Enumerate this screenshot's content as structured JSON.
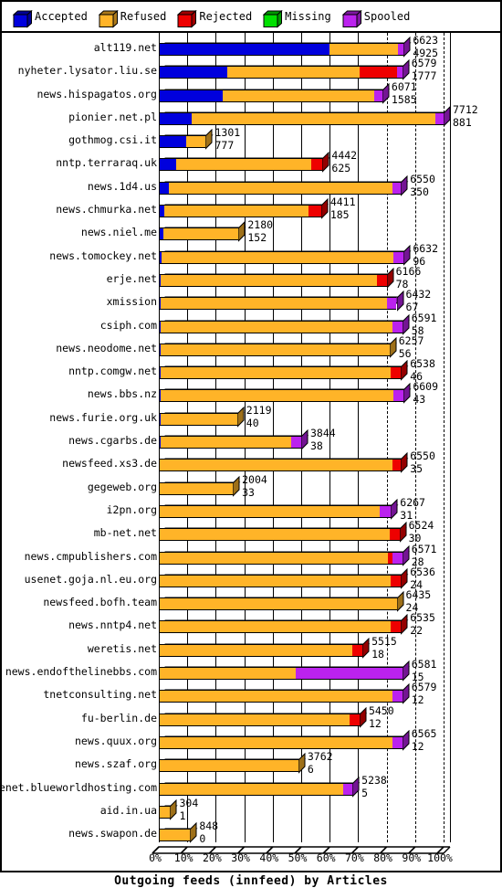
{
  "legend": {
    "items": [
      {
        "label": "Accepted",
        "color": "#0000dd",
        "icon": "cube-icon"
      },
      {
        "label": "Refused",
        "color": "#ffb428",
        "icon": "cube-icon"
      },
      {
        "label": "Rejected",
        "color": "#ee0000",
        "icon": "cube-icon"
      },
      {
        "label": "Missing",
        "color": "#00e000",
        "icon": "cube-icon"
      },
      {
        "label": "Spooled",
        "color": "#bb22ee",
        "icon": "cube-icon"
      }
    ]
  },
  "axis": {
    "title": "Outgoing feeds (innfeed) by Articles",
    "x_ticks": [
      "0%",
      "10%",
      "20%",
      "30%",
      "40%",
      "50%",
      "60%",
      "70%",
      "80%",
      "90%",
      "100%"
    ]
  },
  "chart_data": {
    "type": "bar",
    "orientation": "horizontal",
    "stacked": true,
    "title": "Outgoing feeds (innfeed) by Articles",
    "xlabel": "Outgoing feeds (innfeed) by Articles",
    "ylabel": "",
    "xlim": [
      0,
      100
    ],
    "x_unit": "percent",
    "grid": true,
    "legend_position": "top",
    "series_names": [
      "Accepted",
      "Refused",
      "Rejected",
      "Missing",
      "Spooled"
    ],
    "series_colors": [
      "#0000dd",
      "#ffb428",
      "#ee0000",
      "#00e000",
      "#bb22ee"
    ],
    "categories": [
      "alt119.net",
      "nyheter.lysator.liu.se",
      "news.hispagatos.org",
      "pionier.net.pl",
      "gothmog.csi.it",
      "nntp.terraraq.uk",
      "news.1d4.us",
      "news.chmurka.net",
      "news.niel.me",
      "news.tomockey.net",
      "erje.net",
      "xmission",
      "csiph.com",
      "news.neodome.net",
      "nntp.comgw.net",
      "news.bbs.nz",
      "news.furie.org.uk",
      "news.cgarbs.de",
      "newsfeed.xs3.de",
      "gegeweb.org",
      "i2pn.org",
      "mb-net.net",
      "news.cmpublishers.com",
      "usenet.goja.nl.eu.org",
      "newsfeed.bofh.team",
      "news.nntp4.net",
      "weretis.net",
      "news.endofthelinebbs.com",
      "tnetconsulting.net",
      "fu-berlin.de",
      "news.quux.org",
      "news.szaf.org",
      "usenet.blueworldhosting.com",
      "aid.in.ua",
      "news.swapon.de"
    ],
    "rows": [
      {
        "label": "alt119.net",
        "value_top": "6623",
        "value_bottom": "4925",
        "total_pct": 86,
        "segments": [
          {
            "series": "Accepted",
            "pct": 60.0
          },
          {
            "series": "Refused",
            "pct": 24.0
          },
          {
            "series": "Spooled",
            "pct": 2.0
          }
        ]
      },
      {
        "label": "nyheter.lysator.liu.se",
        "value_top": "6579",
        "value_bottom": "1777",
        "total_pct": 85.5,
        "segments": [
          {
            "series": "Accepted",
            "pct": 24.0
          },
          {
            "series": "Refused",
            "pct": 46.5
          },
          {
            "series": "Rejected",
            "pct": 13.0
          },
          {
            "series": "Spooled",
            "pct": 2.0
          }
        ]
      },
      {
        "label": "news.hispagatos.org",
        "value_top": "6071",
        "value_bottom": "1585",
        "total_pct": 78.5,
        "segments": [
          {
            "series": "Accepted",
            "pct": 22.5
          },
          {
            "series": "Refused",
            "pct": 53.0
          },
          {
            "series": "Spooled",
            "pct": 3.0
          }
        ]
      },
      {
        "label": "pionier.net.pl",
        "value_top": "7712",
        "value_bottom": "881",
        "total_pct": 100.0,
        "segments": [
          {
            "series": "Accepted",
            "pct": 11.5
          },
          {
            "series": "Refused",
            "pct": 85.5
          },
          {
            "series": "Spooled",
            "pct": 3.0
          }
        ]
      },
      {
        "label": "gothmog.csi.it",
        "value_top": "1301",
        "value_bottom": "777",
        "total_pct": 16.5,
        "segments": [
          {
            "series": "Accepted",
            "pct": 9.5
          },
          {
            "series": "Refused",
            "pct": 7.0
          }
        ]
      },
      {
        "label": "nntp.terraraq.uk",
        "value_top": "4442",
        "value_bottom": "625",
        "total_pct": 57.5,
        "segments": [
          {
            "series": "Accepted",
            "pct": 6.0
          },
          {
            "series": "Refused",
            "pct": 47.5
          },
          {
            "series": "Rejected",
            "pct": 4.0
          }
        ]
      },
      {
        "label": "news.1d4.us",
        "value_top": "6550",
        "value_bottom": "350",
        "total_pct": 85.0,
        "segments": [
          {
            "series": "Accepted",
            "pct": 3.5
          },
          {
            "series": "Refused",
            "pct": 78.5
          },
          {
            "series": "Spooled",
            "pct": 3.0
          }
        ]
      },
      {
        "label": "news.chmurka.net",
        "value_top": "4411",
        "value_bottom": "185",
        "total_pct": 57.0,
        "segments": [
          {
            "series": "Accepted",
            "pct": 2.0
          },
          {
            "series": "Refused",
            "pct": 50.5
          },
          {
            "series": "Rejected",
            "pct": 4.5
          }
        ]
      },
      {
        "label": "news.niel.me",
        "value_top": "2180",
        "value_bottom": "152",
        "total_pct": 28.0,
        "segments": [
          {
            "series": "Accepted",
            "pct": 1.5
          },
          {
            "series": "Refused",
            "pct": 26.5
          }
        ]
      },
      {
        "label": "news.tomockey.net",
        "value_top": "6632",
        "value_bottom": "96",
        "total_pct": 86.0,
        "segments": [
          {
            "series": "Accepted",
            "pct": 1.0
          },
          {
            "series": "Refused",
            "pct": 81.5
          },
          {
            "series": "Spooled",
            "pct": 3.5
          }
        ]
      },
      {
        "label": "erje.net",
        "value_top": "6166",
        "value_bottom": "78",
        "total_pct": 80.0,
        "segments": [
          {
            "series": "Accepted",
            "pct": 0.8
          },
          {
            "series": "Refused",
            "pct": 75.7
          },
          {
            "series": "Rejected",
            "pct": 3.5
          }
        ]
      },
      {
        "label": "xmission",
        "value_top": "6432",
        "value_bottom": "67",
        "total_pct": 83.5,
        "segments": [
          {
            "series": "Accepted",
            "pct": 0.7
          },
          {
            "series": "Refused",
            "pct": 79.3
          },
          {
            "series": "Spooled",
            "pct": 3.5
          }
        ]
      },
      {
        "label": "csiph.com",
        "value_top": "6591",
        "value_bottom": "58",
        "total_pct": 85.5,
        "segments": [
          {
            "series": "Accepted",
            "pct": 0.7
          },
          {
            "series": "Refused",
            "pct": 81.3
          },
          {
            "series": "Spooled",
            "pct": 3.5
          }
        ]
      },
      {
        "label": "news.neodome.net",
        "value_top": "6257",
        "value_bottom": "56",
        "total_pct": 81.0,
        "segments": [
          {
            "series": "Accepted",
            "pct": 0.7
          },
          {
            "series": "Refused",
            "pct": 80.3
          }
        ]
      },
      {
        "label": "nntp.comgw.net",
        "value_top": "6538",
        "value_bottom": "46",
        "total_pct": 85.0,
        "segments": [
          {
            "series": "Accepted",
            "pct": 0.6
          },
          {
            "series": "Refused",
            "pct": 80.9
          },
          {
            "series": "Rejected",
            "pct": 3.5
          }
        ]
      },
      {
        "label": "news.bbs.nz",
        "value_top": "6609",
        "value_bottom": "43",
        "total_pct": 86.0,
        "segments": [
          {
            "series": "Accepted",
            "pct": 0.5
          },
          {
            "series": "Refused",
            "pct": 82.0
          },
          {
            "series": "Spooled",
            "pct": 3.5
          }
        ]
      },
      {
        "label": "news.furie.org.uk",
        "value_top": "2119",
        "value_bottom": "40",
        "total_pct": 27.5,
        "segments": [
          {
            "series": "Accepted",
            "pct": 0.5
          },
          {
            "series": "Refused",
            "pct": 27.0
          }
        ]
      },
      {
        "label": "news.cgarbs.de",
        "value_top": "3844",
        "value_bottom": "38",
        "total_pct": 50.0,
        "segments": [
          {
            "series": "Accepted",
            "pct": 0.5
          },
          {
            "series": "Refused",
            "pct": 46.0
          },
          {
            "series": "Spooled",
            "pct": 3.5
          }
        ]
      },
      {
        "label": "newsfeed.xs3.de",
        "value_top": "6550",
        "value_bottom": "35",
        "total_pct": 85.0,
        "segments": [
          {
            "series": "Accepted",
            "pct": 0.4
          },
          {
            "series": "Refused",
            "pct": 81.6
          },
          {
            "series": "Rejected",
            "pct": 3.0
          }
        ]
      },
      {
        "label": "gegeweb.org",
        "value_top": "2004",
        "value_bottom": "33",
        "total_pct": 26.0,
        "segments": [
          {
            "series": "Accepted",
            "pct": 0.4
          },
          {
            "series": "Refused",
            "pct": 25.6
          }
        ]
      },
      {
        "label": "i2pn.org",
        "value_top": "6267",
        "value_bottom": "31",
        "total_pct": 81.5,
        "segments": [
          {
            "series": "Accepted",
            "pct": 0.4
          },
          {
            "series": "Refused",
            "pct": 77.1
          },
          {
            "series": "Spooled",
            "pct": 4.0
          }
        ]
      },
      {
        "label": "mb-net.net",
        "value_top": "6524",
        "value_bottom": "30",
        "total_pct": 84.5,
        "segments": [
          {
            "series": "Accepted",
            "pct": 0.4
          },
          {
            "series": "Refused",
            "pct": 80.6
          },
          {
            "series": "Rejected",
            "pct": 3.5
          }
        ]
      },
      {
        "label": "news.cmpublishers.com",
        "value_top": "6571",
        "value_bottom": "28",
        "total_pct": 85.5,
        "segments": [
          {
            "series": "Accepted",
            "pct": 0.4
          },
          {
            "series": "Refused",
            "pct": 80.1
          },
          {
            "series": "Rejected",
            "pct": 1.5
          },
          {
            "series": "Spooled",
            "pct": 3.5
          }
        ]
      },
      {
        "label": "usenet.goja.nl.eu.org",
        "value_top": "6536",
        "value_bottom": "24",
        "total_pct": 85.0,
        "segments": [
          {
            "series": "Accepted",
            "pct": 0.3
          },
          {
            "series": "Refused",
            "pct": 81.2
          },
          {
            "series": "Rejected",
            "pct": 3.5
          }
        ]
      },
      {
        "label": "newsfeed.bofh.team",
        "value_top": "6435",
        "value_bottom": "24",
        "total_pct": 83.5,
        "segments": [
          {
            "series": "Accepted",
            "pct": 0.3
          },
          {
            "series": "Refused",
            "pct": 83.2
          }
        ]
      },
      {
        "label": "news.nntp4.net",
        "value_top": "6535",
        "value_bottom": "22",
        "total_pct": 85.0,
        "segments": [
          {
            "series": "Accepted",
            "pct": 0.3
          },
          {
            "series": "Refused",
            "pct": 81.2
          },
          {
            "series": "Rejected",
            "pct": 3.5
          }
        ]
      },
      {
        "label": "weretis.net",
        "value_top": "5515",
        "value_bottom": "18",
        "total_pct": 71.5,
        "segments": [
          {
            "series": "Accepted",
            "pct": 0.3
          },
          {
            "series": "Refused",
            "pct": 67.7
          },
          {
            "series": "Rejected",
            "pct": 3.5
          }
        ]
      },
      {
        "label": "news.endofthelinebbs.com",
        "value_top": "6581",
        "value_bottom": "15",
        "total_pct": 85.5,
        "segments": [
          {
            "series": "Accepted",
            "pct": 0.2
          },
          {
            "series": "Refused",
            "pct": 47.8
          },
          {
            "series": "Spooled",
            "pct": 37.5
          }
        ]
      },
      {
        "label": "tnetconsulting.net",
        "value_top": "6579",
        "value_bottom": "12",
        "total_pct": 85.5,
        "segments": [
          {
            "series": "Accepted",
            "pct": 0.2
          },
          {
            "series": "Refused",
            "pct": 81.8
          },
          {
            "series": "Spooled",
            "pct": 3.5
          }
        ]
      },
      {
        "label": "fu-berlin.de",
        "value_top": "5450",
        "value_bottom": "12",
        "total_pct": 70.5,
        "segments": [
          {
            "series": "Accepted",
            "pct": 0.2
          },
          {
            "series": "Refused",
            "pct": 66.8
          },
          {
            "series": "Rejected",
            "pct": 3.5
          }
        ]
      },
      {
        "label": "news.quux.org",
        "value_top": "6565",
        "value_bottom": "12",
        "total_pct": 85.5,
        "segments": [
          {
            "series": "Accepted",
            "pct": 0.2
          },
          {
            "series": "Refused",
            "pct": 81.8
          },
          {
            "series": "Spooled",
            "pct": 3.5
          }
        ]
      },
      {
        "label": "news.szaf.org",
        "value_top": "3762",
        "value_bottom": "6",
        "total_pct": 49.0,
        "segments": [
          {
            "series": "Accepted",
            "pct": 0.2
          },
          {
            "series": "Refused",
            "pct": 48.8
          }
        ]
      },
      {
        "label": "usenet.blueworldhosting.com",
        "value_top": "5238",
        "value_bottom": "5",
        "total_pct": 68.0,
        "segments": [
          {
            "series": "Accepted",
            "pct": 0.2
          },
          {
            "series": "Refused",
            "pct": 64.3
          },
          {
            "series": "Spooled",
            "pct": 3.5
          }
        ]
      },
      {
        "label": "aid.in.ua",
        "value_top": "304",
        "value_bottom": "1",
        "total_pct": 4.0,
        "segments": [
          {
            "series": "Accepted",
            "pct": 0.1
          },
          {
            "series": "Refused",
            "pct": 3.9
          }
        ]
      },
      {
        "label": "news.swapon.de",
        "value_top": "848",
        "value_bottom": "0",
        "total_pct": 11.0,
        "segments": [
          {
            "series": "Refused",
            "pct": 11.0
          }
        ]
      }
    ]
  }
}
